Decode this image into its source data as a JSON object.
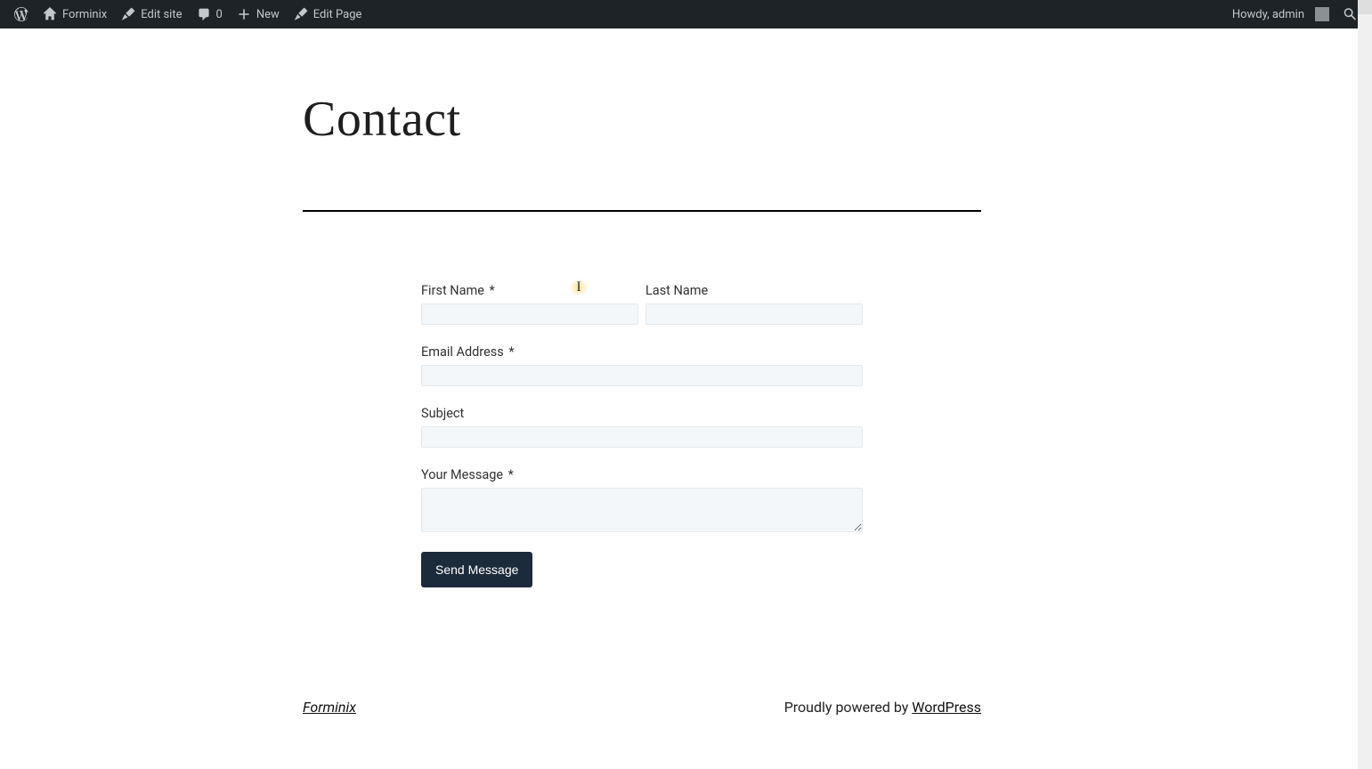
{
  "adminbar": {
    "site_name": "Forminix",
    "edit_site": "Edit site",
    "comments_count": "0",
    "new_label": "New",
    "edit_page": "Edit Page",
    "howdy": "Howdy, admin"
  },
  "page": {
    "title": "Contact"
  },
  "form": {
    "first_name_label": "First Name",
    "last_name_label": "Last Name",
    "email_label": "Email Address",
    "subject_label": "Subject",
    "message_label": "Your Message",
    "required_marker": "*",
    "submit_label": "Send Message",
    "values": {
      "first_name": "",
      "last_name": "",
      "email": "",
      "subject": "",
      "message": ""
    }
  },
  "footer": {
    "site_link": "Forminix",
    "powered_by_text": "Proudly powered by ",
    "wordpress_link": "WordPress"
  },
  "cursor": {
    "glyph": "I"
  }
}
